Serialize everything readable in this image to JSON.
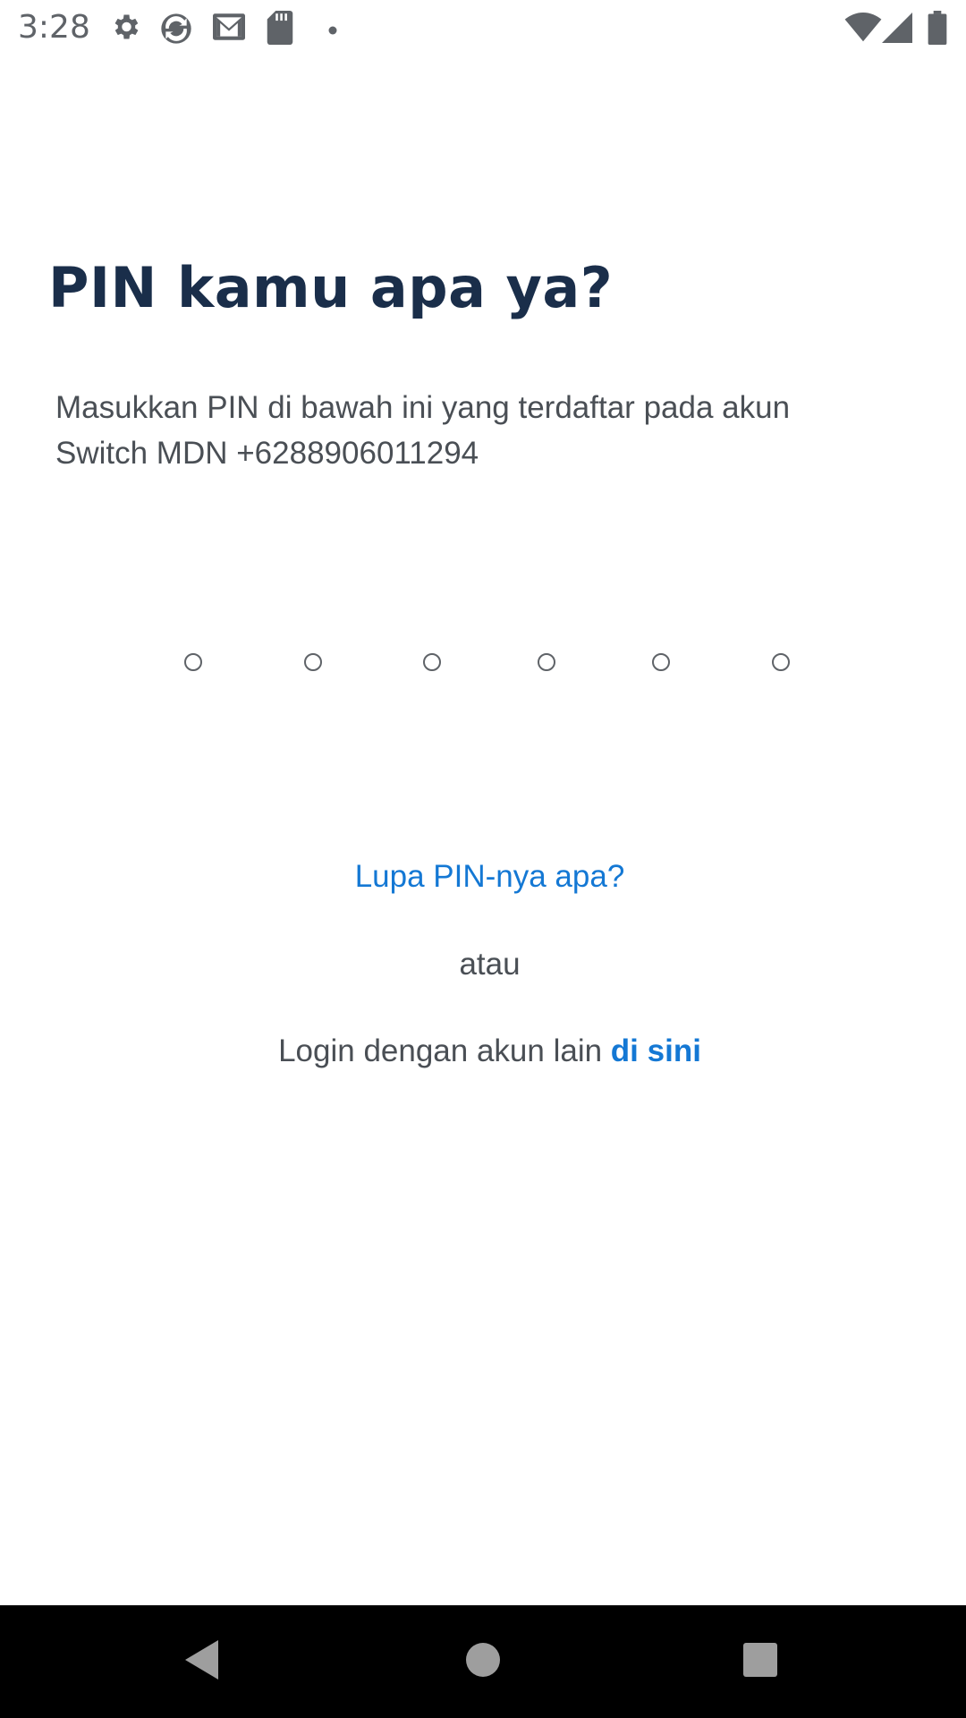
{
  "status_bar": {
    "time": "3:28",
    "left_icons": [
      "gear-icon",
      "sync-icon",
      "gmail-icon",
      "sd-card-icon",
      "dot-icon"
    ],
    "right_icons": [
      "wifi-icon",
      "signal-icon",
      "battery-icon"
    ]
  },
  "main": {
    "title": "PIN kamu apa ya?",
    "subtitle_line1": "Masukkan PIN di bawah ini yang terdaftar pada akun",
    "subtitle_line2": "Switch MDN +6288906011294",
    "pin_length": 6,
    "forgot_pin_link": "Lupa PIN-nya apa?",
    "or_text": "atau",
    "login_other_prefix": "Login dengan akun lain ",
    "login_other_link": "di sini"
  },
  "nav_bar": {
    "buttons": [
      "back-icon",
      "home-icon",
      "recents-icon"
    ]
  },
  "colors": {
    "title": "#1a2e4a",
    "body_text": "#4a4f55",
    "link": "#1478d4",
    "nav_bar_bg": "#000000"
  }
}
